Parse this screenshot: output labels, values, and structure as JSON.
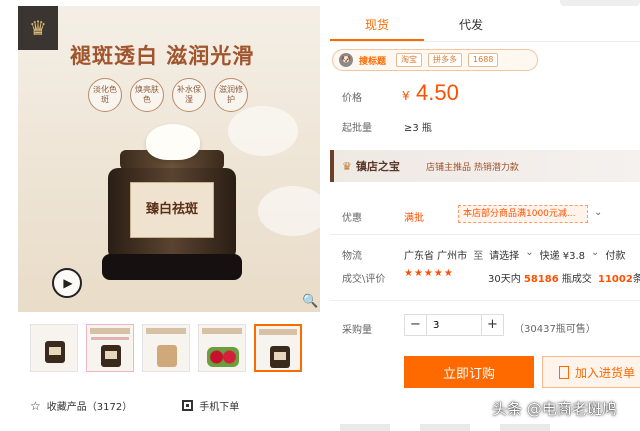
{
  "gallery": {
    "headline": "褪斑透白 滋润光滑",
    "feature_badges": [
      "淡化色斑",
      "焕亮肤色",
      "补水保湿",
      "滋润修护"
    ],
    "jar_label": "臻白祛斑",
    "thumbnails": [
      "thumb-1",
      "thumb-2",
      "thumb-3",
      "thumb-4",
      "thumb-5"
    ],
    "favorite_label": "收藏产品（3172）",
    "mobile_order_label": "手机下单"
  },
  "tabs": [
    "现货",
    "代发"
  ],
  "source_tags": {
    "brand": "搜标题",
    "platforms": [
      "淘宝",
      "拼多多",
      "1688"
    ]
  },
  "price": {
    "label": "价格",
    "symbol": "¥",
    "value": "4.50"
  },
  "moq": {
    "label": "起批量",
    "value": "≥3 瓶"
  },
  "shop_banner": {
    "title": "镇店之宝",
    "subtitle": "店铺主推品  热销潜力款"
  },
  "promo": {
    "label": "优惠",
    "tag": "满批",
    "text": "本店部分商品满1000元减..."
  },
  "shipping": {
    "label": "物流",
    "origin": "广东省 广州市",
    "to": "至",
    "destination": "请选择",
    "express": "快递 ¥3.8",
    "extra": "付款"
  },
  "sales": {
    "label": "成交\\评价",
    "stars": "★★★★★",
    "prefix": "30天内",
    "count": "58186",
    "suffix": "瓶成交",
    "review_count": "11002",
    "review_suffix": "条"
  },
  "quantity": {
    "label": "采购量",
    "minus": "−",
    "value": "3",
    "plus": "+",
    "stock": "（30437瓶可售）"
  },
  "actions": {
    "buy_now": "立即订购",
    "add_to_list": "加入进货单"
  },
  "watermark": "头条 @电商老斑鸠",
  "colors": {
    "accent": "#ff6a00",
    "price": "#ff5000"
  }
}
